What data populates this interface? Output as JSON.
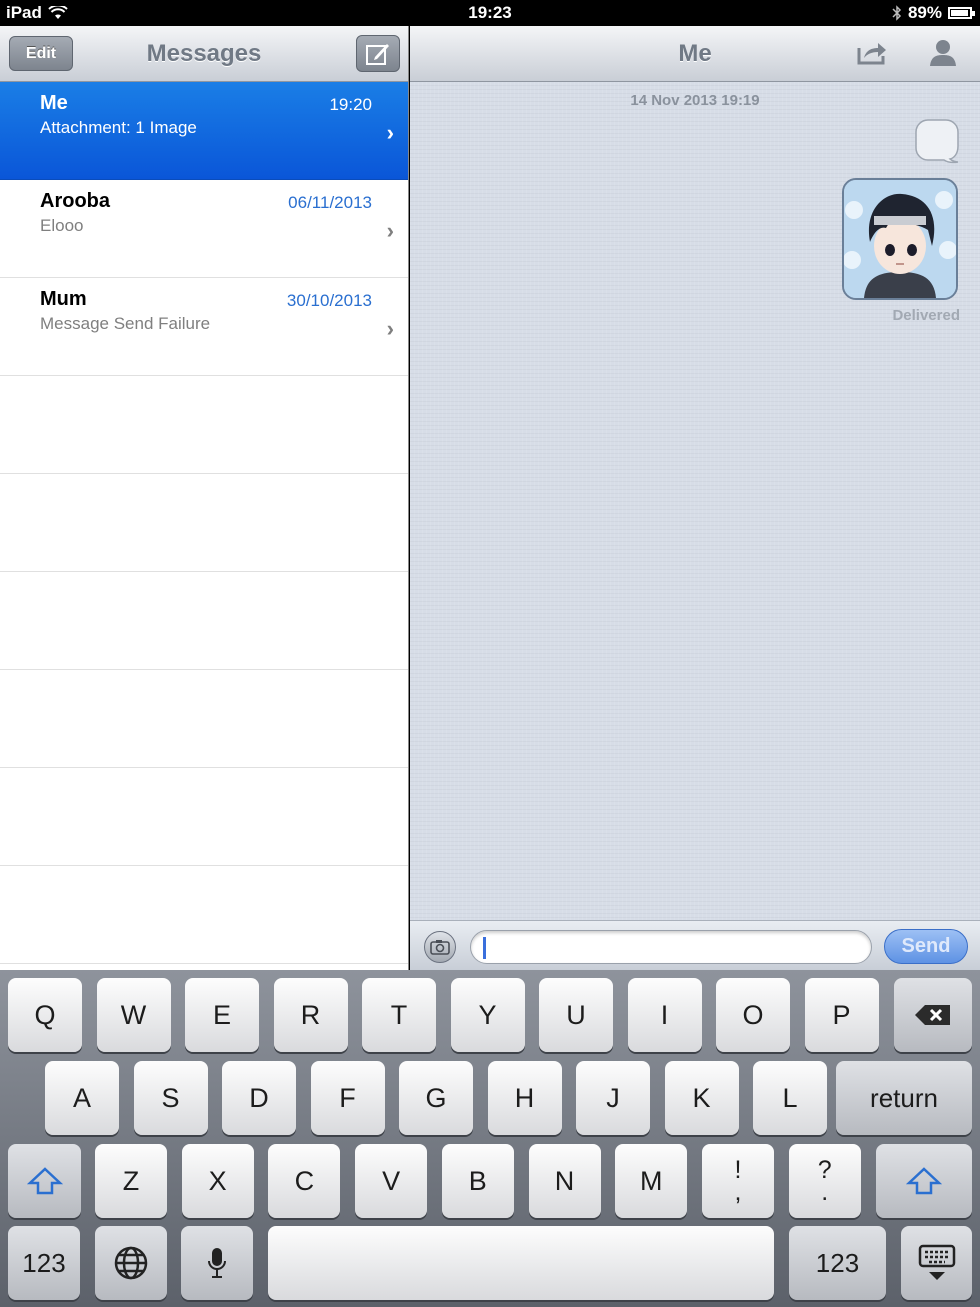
{
  "status": {
    "device": "iPad",
    "time": "19:23",
    "battery": "89%"
  },
  "sidebar": {
    "title": "Messages",
    "edit_label": "Edit",
    "conversations": [
      {
        "name": "Me",
        "preview": "Attachment: 1 Image",
        "date": "19:20",
        "selected": true
      },
      {
        "name": "Arooba",
        "preview": "Elooo",
        "date": "06/11/2013",
        "selected": false
      },
      {
        "name": "Mum",
        "preview": "Message Send Failure",
        "date": "30/10/2013",
        "selected": false
      }
    ]
  },
  "thread": {
    "title": "Me",
    "timestamp": "14 Nov 2013 19:19",
    "status": "Delivered"
  },
  "composer": {
    "send_label": "Send",
    "value": ""
  },
  "keyboard": {
    "row1": [
      "Q",
      "W",
      "E",
      "R",
      "T",
      "Y",
      "U",
      "I",
      "O",
      "P"
    ],
    "row2": [
      "A",
      "S",
      "D",
      "F",
      "G",
      "H",
      "J",
      "K",
      "L"
    ],
    "row2_return": "return",
    "row3": [
      "Z",
      "X",
      "C",
      "V",
      "B",
      "N",
      "M"
    ],
    "row3_punct": [
      [
        "!",
        ","
      ],
      [
        "?",
        "."
      ]
    ],
    "numbers_label": "123"
  },
  "colors": {
    "selection": "#0a56d8",
    "date": "#2a6fd0",
    "send": "#5e92e4"
  }
}
